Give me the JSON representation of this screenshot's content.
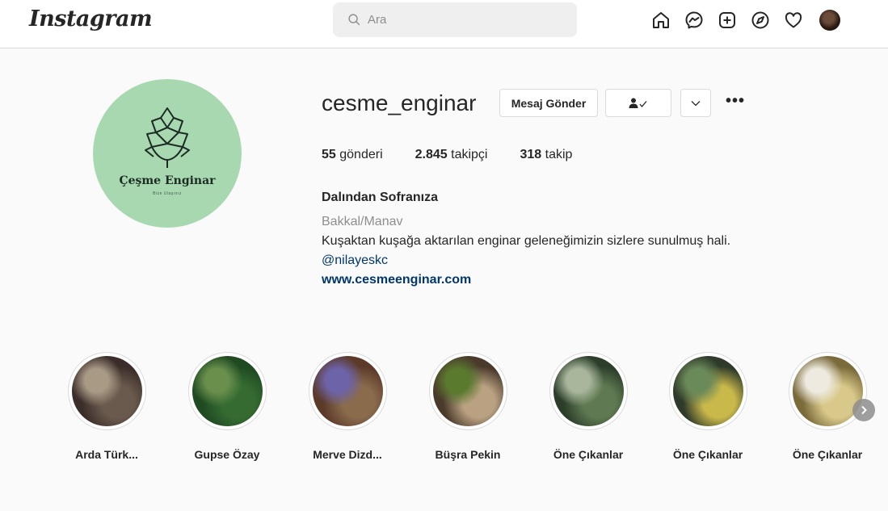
{
  "header": {
    "logo": "Instagram",
    "search_placeholder": "Ara",
    "nav_icons": [
      "home-icon",
      "messenger-icon",
      "new-post-icon",
      "explore-icon",
      "activity-heart-icon",
      "profile-avatar"
    ]
  },
  "profile": {
    "username": "cesme_enginar",
    "pic_brand": "Çeşme Enginar",
    "pic_brand_sub": "Bize Ulaşınız",
    "buttons": {
      "message": "Mesaj Gönder",
      "follow_icon": "person-check-icon",
      "more_chevron": "chevron-down-icon",
      "options": "•••"
    },
    "stats": {
      "posts_count": "55",
      "posts_label": "gönderi",
      "followers_count": "2.845",
      "followers_label": "takipçi",
      "following_count": "318",
      "following_label": "takip"
    },
    "bio": {
      "name": "Dalından Sofranıza",
      "category": "Bakkal/Manav",
      "text": "Kuşaktan kuşağa aktarılan enginar geleneğimizin sizlere sunulmuş hali.",
      "mention": "@nilayeskc",
      "website": "www.cesmeenginar.com"
    }
  },
  "highlights": [
    {
      "label": "Arda Türk...",
      "colors": [
        "#3b2e2a",
        "#6a5a4e",
        "#a99a86"
      ]
    },
    {
      "label": "Gupse Özay",
      "colors": [
        "#1f4a22",
        "#356b31",
        "#6a8f4d"
      ]
    },
    {
      "label": "Merve Dizd...",
      "colors": [
        "#5b3a2a",
        "#8a6b4c",
        "#6d63a8"
      ]
    },
    {
      "label": "Büşra Pekin",
      "colors": [
        "#4a3a2c",
        "#b9a181",
        "#5a7a2e"
      ]
    },
    {
      "label": "Öne Çıkanlar",
      "colors": [
        "#2c3e2a",
        "#5f7a52",
        "#a9b69c"
      ]
    },
    {
      "label": "Öne Çıkanlar",
      "colors": [
        "#2f3b2a",
        "#c9b84a",
        "#6b8a5a"
      ]
    },
    {
      "label": "Öne Çıkanlar",
      "colors": [
        "#7b6a3a",
        "#d8c98a",
        "#eeeadf"
      ]
    }
  ],
  "colors": {
    "profile_bg": "#a8d8b0",
    "link": "#00376b",
    "muted": "#8e8e8e",
    "border": "#dbdbdb"
  }
}
